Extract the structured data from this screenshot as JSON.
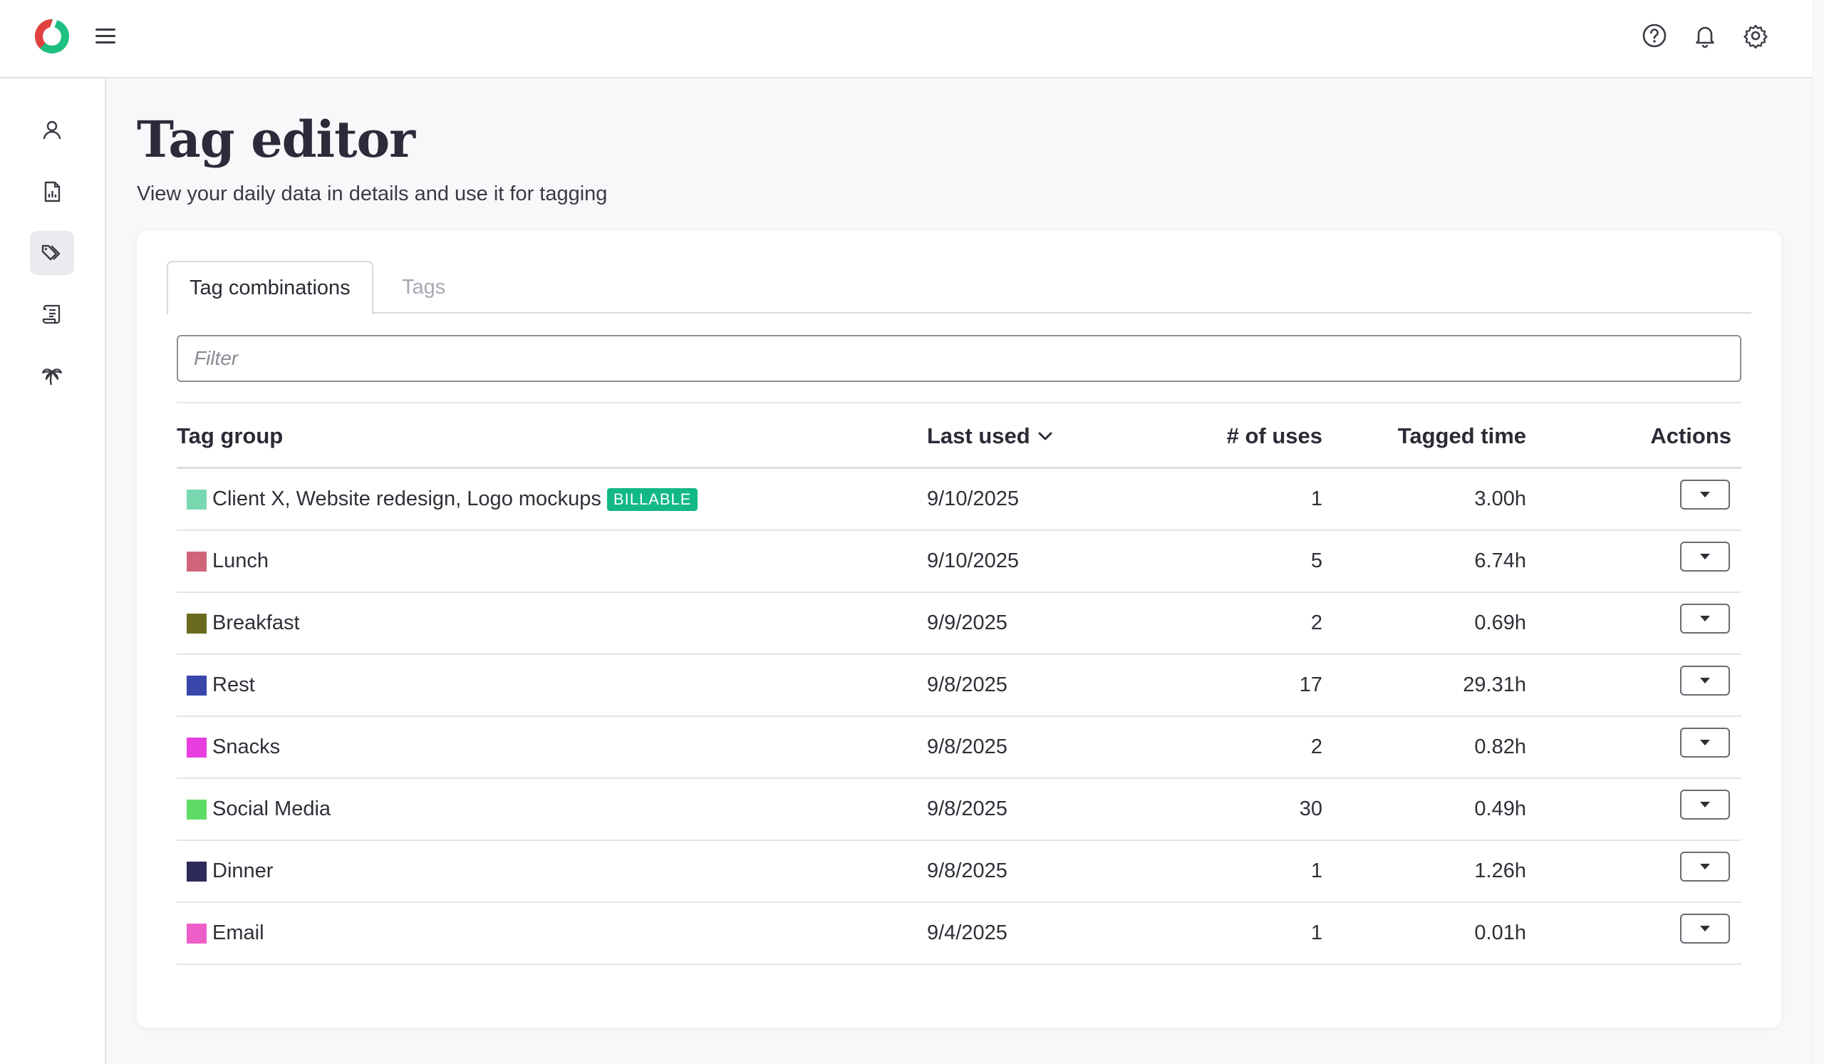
{
  "header": {
    "logo_icon": "app-logo",
    "menu_icon": "hamburger-icon",
    "help_icon": "help-circle-icon",
    "bell_icon": "bell-icon",
    "settings_icon": "gear-icon"
  },
  "sidebar": {
    "items": [
      {
        "icon": "user-icon",
        "active": false
      },
      {
        "icon": "report-icon",
        "active": false
      },
      {
        "icon": "tags-icon",
        "active": true
      },
      {
        "icon": "scroll-icon",
        "active": false
      },
      {
        "icon": "palm-tree-icon",
        "active": false
      }
    ]
  },
  "page": {
    "title": "Tag editor",
    "subtitle": "View your daily data in details and use it for tagging"
  },
  "tabs": [
    {
      "label": "Tag combinations",
      "active": true
    },
    {
      "label": "Tags",
      "active": false
    }
  ],
  "filter": {
    "placeholder": "Filter",
    "value": ""
  },
  "table": {
    "headers": {
      "group": "Tag group",
      "last_used": "Last used",
      "uses": "# of uses",
      "time": "Tagged time",
      "actions": "Actions"
    },
    "sort_icon": "chevron-down-icon",
    "rows": [
      {
        "color": "#79d8b0",
        "name": "Client X, Website redesign, Logo mockups",
        "badge": "BILLABLE",
        "last_used": "9/10/2025",
        "uses": "1",
        "time": "3.00h"
      },
      {
        "color": "#d0657a",
        "name": "Lunch",
        "badge": "",
        "last_used": "9/10/2025",
        "uses": "5",
        "time": "6.74h"
      },
      {
        "color": "#6b6b1f",
        "name": "Breakfast",
        "badge": "",
        "last_used": "9/9/2025",
        "uses": "2",
        "time": "0.69h"
      },
      {
        "color": "#3947ab",
        "name": "Rest",
        "badge": "",
        "last_used": "9/8/2025",
        "uses": "17",
        "time": "29.31h"
      },
      {
        "color": "#e83ee0",
        "name": "Snacks",
        "badge": "",
        "last_used": "9/8/2025",
        "uses": "2",
        "time": "0.82h"
      },
      {
        "color": "#5fdc66",
        "name": "Social Media",
        "badge": "",
        "last_used": "9/8/2025",
        "uses": "30",
        "time": "0.49h"
      },
      {
        "color": "#2d2a59",
        "name": "Dinner",
        "badge": "",
        "last_used": "9/8/2025",
        "uses": "1",
        "time": "1.26h"
      },
      {
        "color": "#ee5ec9",
        "name": "Email",
        "badge": "",
        "last_used": "9/4/2025",
        "uses": "1",
        "time": "0.01h"
      }
    ]
  }
}
